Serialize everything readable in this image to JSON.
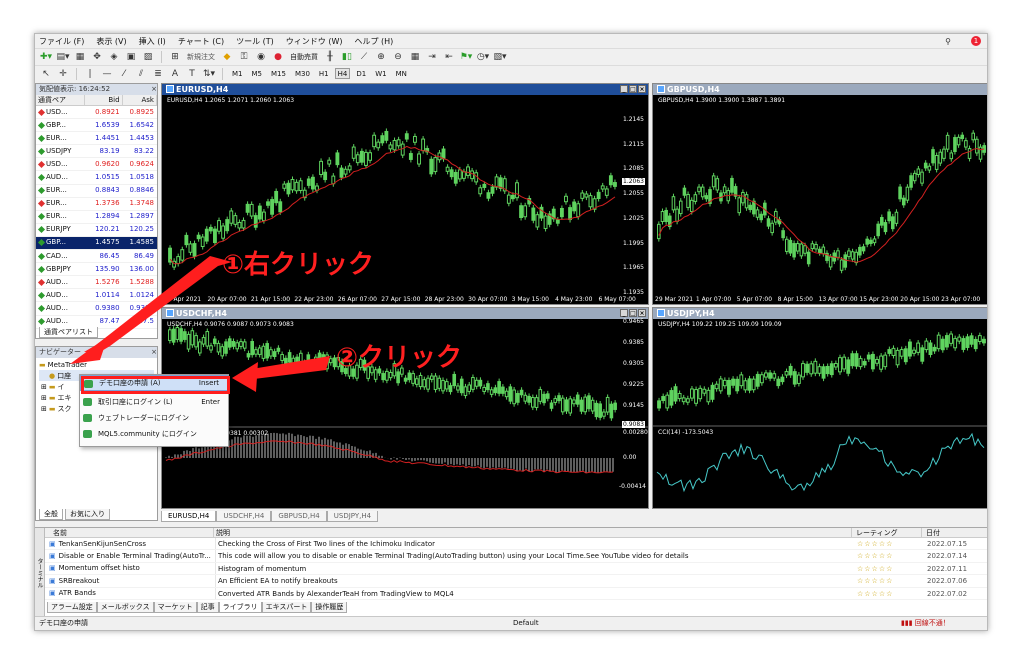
{
  "menu": [
    "ファイル (F)",
    "表示 (V)",
    "挿入 (I)",
    "チャート (C)",
    "ツール (T)",
    "ウィンドウ (W)",
    "ヘルプ (H)"
  ],
  "toolbar": {
    "new_order": "新規注文",
    "auto_trading": "自動売買",
    "timeframes": [
      "M1",
      "M5",
      "M15",
      "M30",
      "H1",
      "H4",
      "D1",
      "W1",
      "MN"
    ],
    "active_timeframe": "H4"
  },
  "market_watch": {
    "title": "気配値表示: 16:24:52",
    "columns": [
      "通貨ペア",
      "Bid",
      "Ask"
    ],
    "rows": [
      {
        "symbol": "USD...",
        "bid": "0.8921",
        "ask": "0.8925",
        "dir": "dn"
      },
      {
        "symbol": "GBP...",
        "bid": "1.6539",
        "ask": "1.6542",
        "dir": "up"
      },
      {
        "symbol": "EUR...",
        "bid": "1.4451",
        "ask": "1.4453",
        "dir": "up"
      },
      {
        "symbol": "USDJPY",
        "bid": "83.19",
        "ask": "83.22",
        "dir": "up"
      },
      {
        "symbol": "USD...",
        "bid": "0.9620",
        "ask": "0.9624",
        "dir": "dn"
      },
      {
        "symbol": "AUD...",
        "bid": "1.0515",
        "ask": "1.0518",
        "dir": "up"
      },
      {
        "symbol": "EUR...",
        "bid": "0.8843",
        "ask": "0.8846",
        "dir": "up"
      },
      {
        "symbol": "EUR...",
        "bid": "1.3736",
        "ask": "1.3748",
        "dir": "dn"
      },
      {
        "symbol": "EUR...",
        "bid": "1.2894",
        "ask": "1.2897",
        "dir": "up"
      },
      {
        "symbol": "EURJPY",
        "bid": "120.21",
        "ask": "120.25",
        "dir": "up"
      },
      {
        "symbol": "GBP...",
        "bid": "1.4575",
        "ask": "1.4585",
        "dir": "up",
        "selected": true
      },
      {
        "symbol": "CAD...",
        "bid": "86.45",
        "ask": "86.49",
        "dir": "up"
      },
      {
        "symbol": "GBPJPY",
        "bid": "135.90",
        "ask": "136.00",
        "dir": "up"
      },
      {
        "symbol": "AUD...",
        "bid": "1.5276",
        "ask": "1.5288",
        "dir": "dn"
      },
      {
        "symbol": "AUD...",
        "bid": "1.0114",
        "ask": "1.0124",
        "dir": "up"
      },
      {
        "symbol": "AUD...",
        "bid": "0.9380",
        "ask": "0.9388",
        "dir": "up"
      },
      {
        "symbol": "AUD...",
        "bid": "87.47",
        "ask": "87.5",
        "dir": "up"
      }
    ],
    "tab": "通貨ペアリスト"
  },
  "navigator": {
    "title": "ナビゲーター",
    "root": "MetaTrader",
    "items": [
      "口座",
      "イ",
      "エキ",
      "スク"
    ],
    "tabs": [
      "全般",
      "お気に入り"
    ]
  },
  "context_menu": {
    "items": [
      {
        "label": "デモ口座の申請 (A)",
        "key": "Insert"
      },
      {
        "label": "取引口座にログイン (L)",
        "key": "Enter"
      },
      {
        "label": "ウェブトレーダーにログイン",
        "key": ""
      },
      {
        "label": "MQL5.community にログイン",
        "key": ""
      }
    ]
  },
  "annotations": {
    "step1": "①右クリック",
    "step2": "②クリック"
  },
  "charts": [
    {
      "title": "EURUSD,H4",
      "ohlc": "EURUSD,H4  1.2065 1.2071 1.2060 1.2063",
      "prices": [
        "1.2145",
        "1.2115",
        "1.2085",
        "1.2055",
        "1.2025",
        "1.1995",
        "1.1965",
        "1.1935"
      ],
      "current": "1.2063",
      "dates": [
        "18 Apr 2021",
        "20 Apr 07:00",
        "21 Apr 15:00",
        "22 Apr 23:00",
        "26 Apr 07:00",
        "27 Apr 15:00",
        "28 Apr 23:00",
        "30 Apr 07:00",
        "3 May 15:00",
        "4 May 23:00",
        "6 May 07:00"
      ]
    },
    {
      "title": "GBPUSD,H4",
      "ohlc": "GBPUSD,H4  1.3900 1.3900 1.3887 1.3891",
      "dates": [
        "29 Mar 2021",
        "1 Apr 07:00",
        "5 Apr 07:00",
        "8 Apr 15:00",
        "13 Apr 07:00",
        "15 Apr 23:00",
        "20 Apr 15:00",
        "23 Apr 07:00"
      ]
    },
    {
      "title": "USDCHF,H4",
      "ohlc": "USDCHF,H4  0.9076 0.9087 0.9073 0.9083",
      "prices": [
        "0.9465",
        "0.9385",
        "0.9305",
        "0.9225",
        "0.9145"
      ],
      "current": "0.9083",
      "macd": "MACD(12,26,9) -0.00381 0.00302",
      "macd_levels": [
        "0.00280",
        "0.00",
        "-0.00414"
      ]
    },
    {
      "title": "USDJPY,H4",
      "ohlc": "USDJPY,H4  109.22 109.25 109.09 109.09",
      "cci": "CCI(14) -173.5043"
    }
  ],
  "chart_tabs": [
    "EURUSD,H4",
    "USDCHF,H4",
    "GBPUSD,H4",
    "USDJPY,H4"
  ],
  "terminal": {
    "columns": [
      "名前",
      "説明",
      "レーティング",
      "日付"
    ],
    "rows": [
      {
        "name": "TenkanSenKijunSenCross",
        "desc": "Checking the Cross of First Two lines of the Ichimoku Indicator",
        "date": "2022.07.15"
      },
      {
        "name": "Disable or Enable Terminal Trading(AutoTr...",
        "desc": "This code will allow you to disable or enable Terminal Trading(AutoTrading button) using your Local Time.See YouTube video for details",
        "date": "2022.07.14"
      },
      {
        "name": "Momentum offset histo",
        "desc": "Histogram of momentum",
        "date": "2022.07.11"
      },
      {
        "name": "SRBreakout",
        "desc": "An Efficient EA to notify breakouts",
        "date": "2022.07.06"
      },
      {
        "name": "ATR Bands",
        "desc": "Converted ATR Bands by AlexanderTeaH from TradingView to MQL4",
        "date": "2022.07.02"
      }
    ],
    "stars": "☆☆☆☆☆",
    "tabs": [
      "アラーム設定",
      "メールボックス",
      "マーケット",
      "記事",
      "ライブラリ",
      "エキスパート",
      "操作履歴"
    ],
    "active_tab": "ライブラリ",
    "side_label": "ターミナル"
  },
  "status": {
    "left": "デモ口座の申請",
    "middle": "Default",
    "right": "回線不通！"
  },
  "colors": {
    "accent": "#ff1e1e",
    "candle": "#5fd35f",
    "ma": "#d22020",
    "cci": "#46c8c8"
  }
}
